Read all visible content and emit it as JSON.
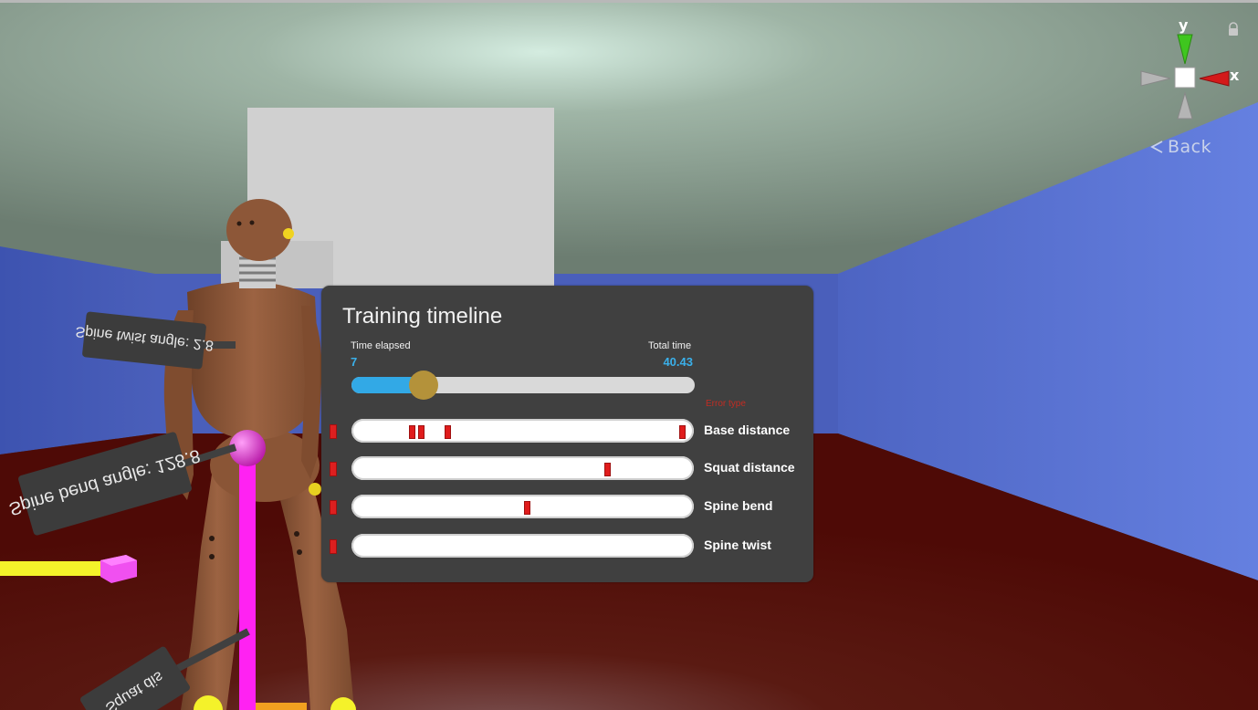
{
  "gizmo": {
    "y_label": "y",
    "x_label": "x",
    "lock_icon": "lock-icon"
  },
  "navigation": {
    "back_label": "Back",
    "back_icon": "chevron-left-icon"
  },
  "scene_labels": {
    "spine_twist": "Spine twist angle: 2.8",
    "spine_bend": "Spine bend angle: 128.8",
    "squat": "Squat dis"
  },
  "timeline": {
    "title": "Training timeline",
    "time_elapsed_label": "Time elapsed",
    "time_elapsed_value": "7",
    "total_time_label": "Total time",
    "total_time_value": "40.43",
    "progress_fraction": 0.209,
    "error_type_label": "Error type",
    "tracks": [
      {
        "label": "Base distance",
        "errors": [
          0.172,
          0.198,
          0.277,
          0.978
        ]
      },
      {
        "label": "Squat distance",
        "errors": [
          0.755
        ]
      },
      {
        "label": "Spine bend",
        "errors": [
          0.515
        ]
      },
      {
        "label": "Spine twist",
        "errors": []
      }
    ]
  },
  "colors": {
    "panel_bg": "#404040",
    "accent_blue": "#32a9e6",
    "slider_handle": "#b4923a",
    "error_red": "#e01c1c",
    "wall_blue": "#5b74d4",
    "floor_red": "#5c0e08",
    "ceiling": "#889a8c",
    "pointer_magenta": "#ff22f2",
    "pointer_yellow": "#f4f22a"
  }
}
